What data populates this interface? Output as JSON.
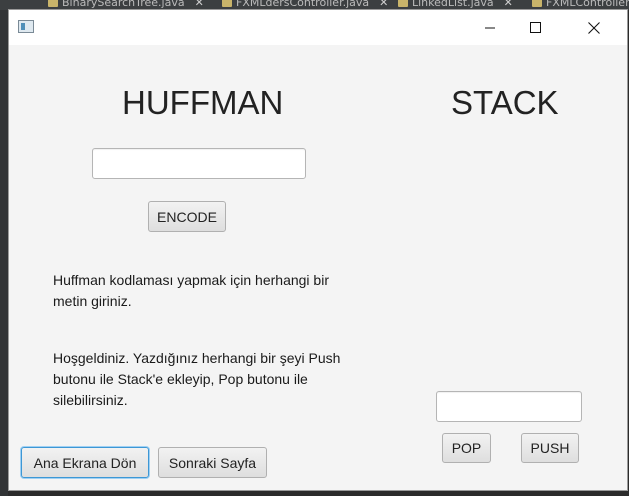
{
  "ide": {
    "tabs": [
      {
        "label": "BinarySearchTree.java"
      },
      {
        "label": "FXMLdersController.java"
      },
      {
        "label": "LinkedList.java"
      },
      {
        "label": "FXMLController"
      }
    ]
  },
  "window": {
    "icon": "java-app-icon",
    "controls": {
      "minimize": "minimize-icon",
      "maximize": "maximize-icon",
      "close": "close-icon"
    }
  },
  "huffman": {
    "title": "HUFFMAN",
    "input_value": "",
    "encode_label": "ENCODE",
    "info_text": "Huffman kodlaması yapmak için herhangi bir metin giriniz."
  },
  "stack": {
    "title": "STACK",
    "description": "Hoşgeldiniz. Yazdığınız herhangi bir şeyi Push butonu ile Stack'e ekleyip, Pop butonu ile silebilirsiniz.",
    "input_value": "",
    "pop_label": "POP",
    "push_label": "PUSH"
  },
  "footer": {
    "back_label": "Ana Ekrana Dön",
    "next_label": "Sonraki Sayfa"
  },
  "colors": {
    "focus_border": "#3d97d5",
    "window_bg": "#f4f4f4"
  }
}
